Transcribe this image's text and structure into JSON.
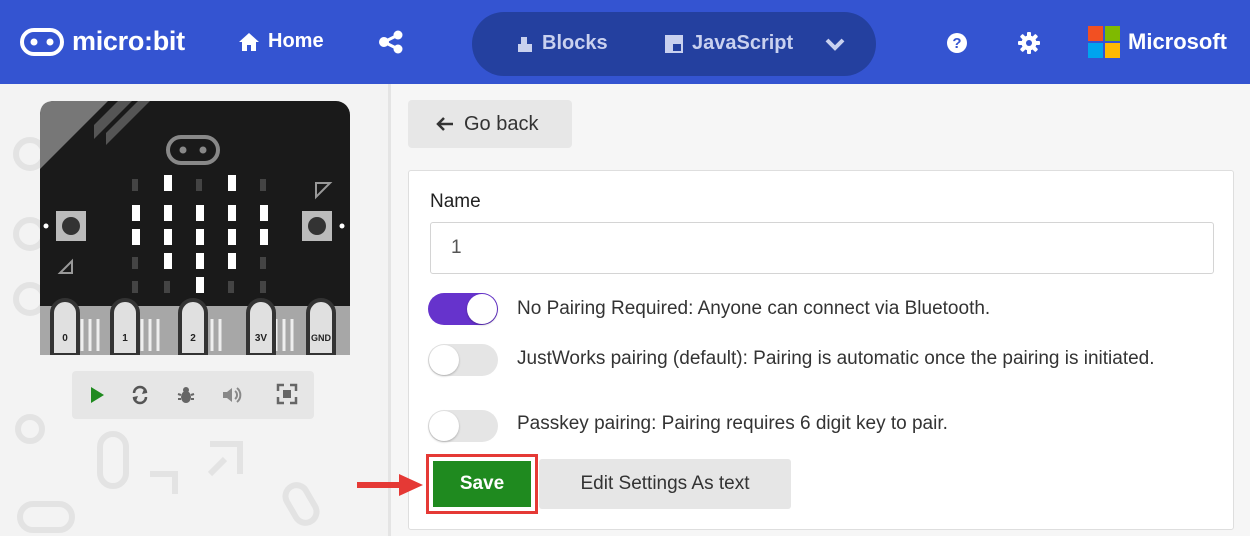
{
  "header": {
    "brand": "micro:bit",
    "home_label": "Home",
    "tabs": [
      {
        "label": "Blocks"
      },
      {
        "label": "JavaScript"
      }
    ],
    "vendor": "Microsoft"
  },
  "simulator": {
    "pin_labels": [
      "0",
      "1",
      "2",
      "3V",
      "GND"
    ]
  },
  "settings": {
    "go_back_label": "Go back",
    "name_label": "Name",
    "name_value": "1",
    "options": [
      {
        "label": "No Pairing Required: Anyone can connect via Bluetooth.",
        "enabled": true
      },
      {
        "label": "JustWorks pairing (default): Pairing is automatic once the pairing is initiated.",
        "enabled": false
      },
      {
        "label": "Passkey pairing: Pairing requires 6 digit key to pair.",
        "enabled": false
      }
    ],
    "save_label": "Save",
    "edit_text_label": "Edit Settings As text"
  },
  "colors": {
    "header": "#3454d1",
    "toggle_on": "#6633cc",
    "save": "#1f8a1f",
    "highlight": "#e53935"
  }
}
